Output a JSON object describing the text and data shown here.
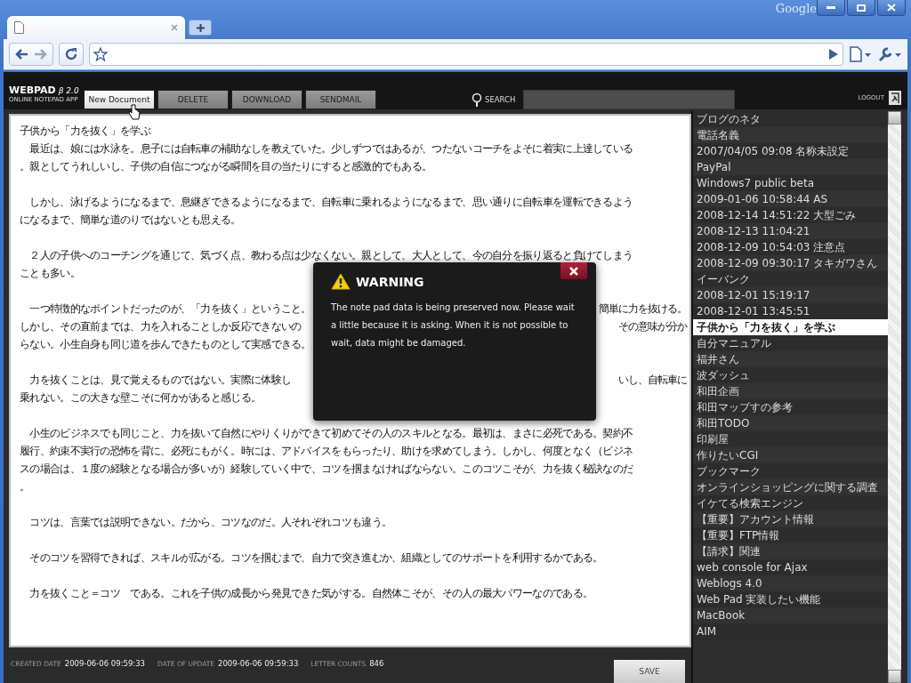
{
  "browser": {
    "brand": "Google"
  },
  "app": {
    "logo": "WEBPAD",
    "version": "β 2.0",
    "tagline": "ONLINE NOTEPAD APP",
    "buttons": [
      {
        "label": "New Document",
        "selected": true
      },
      {
        "label": "DELETE",
        "selected": false
      },
      {
        "label": "DOWNLOAD",
        "selected": false
      },
      {
        "label": "SENDMAIL",
        "selected": false
      }
    ],
    "search_label": "SEARCH",
    "logout": "LOGOUT"
  },
  "editor": {
    "title": "子供から「力を抜く」を学ぶ",
    "paragraphs": [
      {
        "lines": [
          {
            "kind": "full",
            "text": "　最近は、娘には水泳を。息子には自転車の補助なしを教えていた。少しずつではあるが、つたないコーチをよそに着実に上達している"
          },
          {
            "kind": "full",
            "text": "。親としてうれしいし、子供の自信につながる瞬間を目の当たりにすると感激的でもある。"
          }
        ]
      },
      {
        "lines": [
          {
            "kind": "full",
            "text": "　しかし、泳げるようになるまで、息継ぎできるようになるまで、自転車に乗れるようになるまで、思い通りに自転車を運転できるよう"
          },
          {
            "kind": "full",
            "text": "になるまで、簡単な道のりではないとも思える。"
          }
        ]
      },
      {
        "lines": [
          {
            "kind": "full",
            "text": "　２人の子供へのコーチングを通じて、気づく点、教わる点は少なくない。親として、大人として、今の自分を振り返ると負けてしまう"
          },
          {
            "kind": "full",
            "text": "ことも多い。"
          }
        ]
      },
      {
        "lines": [
          {
            "kind": "split",
            "left": "　一つ特徴的なポイントだったのが、「力を抜く」ということ。",
            "right": "簡単に力を抜ける。"
          },
          {
            "kind": "split",
            "left": "しかし、その直前までは、力を入れることしか反応できないの",
            "right": "その意味が分か"
          },
          {
            "kind": "full",
            "text": "らない。小生自身も同じ道を歩んできたものとして実感できる。"
          }
        ]
      },
      {
        "lines": [
          {
            "kind": "split",
            "left": "　力を抜くことは、見て覚えるものではない。実際に体験し",
            "right": "いし、自転車に"
          },
          {
            "kind": "full",
            "text": "乗れない。この大きな壁こそに何かがあると感じる。"
          }
        ]
      },
      {
        "lines": [
          {
            "kind": "full",
            "text": "　小生のビジネスでも同じこと、力を抜いて自然にやりくりができて初めてその人のスキルとなる。最初は、まさに必死である。契約不"
          },
          {
            "kind": "full",
            "text": "履行、約束不実行の恐怖を背に、必死にもがく。時には、アドバイスをもらったり、助けを求めてしまう。しかし、何度となく（ビジネ"
          },
          {
            "kind": "full",
            "text": "スの場合は、１度の経験となる場合が多いが）経験していく中で、コツを掴まなければならない。このコツこそが、力を抜く秘訣なのだ"
          },
          {
            "kind": "full",
            "text": "。"
          }
        ]
      },
      {
        "lines": [
          {
            "kind": "full",
            "text": "　コツは、言葉では説明できない。だから、コツなのだ。人それぞれコツも違う。"
          }
        ]
      },
      {
        "lines": [
          {
            "kind": "full",
            "text": "　そのコツを習得できれば、スキルが広がる。コツを掴むまで、自力で突き進むか、組織としてのサポートを利用するかである。"
          }
        ]
      },
      {
        "lines": [
          {
            "kind": "full",
            "text": "　力を抜くこと＝コツ　である。これを子供の成長から発見できた気がする。自然体こそが、その人の最大パワーなのである。"
          }
        ]
      }
    ]
  },
  "footer": {
    "fields": [
      {
        "label": "CREATED DATE",
        "value": "2009-06-06 09:59:33"
      },
      {
        "label": "DATE OF UPDATE",
        "value": "2009-06-06 09:59:33"
      },
      {
        "label": "LETTER COUNTS",
        "value": "846"
      }
    ],
    "save": "SAVE"
  },
  "notes": [
    {
      "title": "ブログのネタ",
      "selected": false
    },
    {
      "title": "電話名義",
      "selected": false
    },
    {
      "title": "2007/04/05 09:08 名称未設定",
      "selected": false
    },
    {
      "title": "PayPal",
      "selected": false
    },
    {
      "title": "Windows7 public beta",
      "selected": false
    },
    {
      "title": "2009-01-06 10:58:44 AS",
      "selected": false
    },
    {
      "title": "2008-12-14 14:51:22 大型ごみ",
      "selected": false
    },
    {
      "title": "2008-12-13 11:04:21",
      "selected": false
    },
    {
      "title": "2008-12-09 10:54:03 注意点",
      "selected": false
    },
    {
      "title": "2008-12-09 09:30:17 タキガワさん",
      "selected": false
    },
    {
      "title": "イーバンク",
      "selected": false
    },
    {
      "title": "2008-12-01 15:19:17",
      "selected": false
    },
    {
      "title": "2008-12-01 13:45:51",
      "selected": false
    },
    {
      "title": "子供から「力を抜く」を学ぶ",
      "selected": true
    },
    {
      "title": "自分マニュアル",
      "selected": false
    },
    {
      "title": "福井さん",
      "selected": false
    },
    {
      "title": "波ダッシュ",
      "selected": false
    },
    {
      "title": "和田企画",
      "selected": false
    },
    {
      "title": "和田マップすの参考",
      "selected": false
    },
    {
      "title": "和田TODO",
      "selected": false
    },
    {
      "title": "印刷屋",
      "selected": false
    },
    {
      "title": "作りたいCGI",
      "selected": false
    },
    {
      "title": "ブックマーク",
      "selected": false
    },
    {
      "title": "オンラインショッピングに関する調査",
      "selected": false
    },
    {
      "title": "イケてる検索エンジン",
      "selected": false
    },
    {
      "title": "【重要】アカウント情報",
      "selected": false
    },
    {
      "title": "【重要】FTP情報",
      "selected": false
    },
    {
      "title": "【請求】関連",
      "selected": false
    },
    {
      "title": "web console for Ajax",
      "selected": false
    },
    {
      "title": "Weblogs 4.0",
      "selected": false
    },
    {
      "title": "Web Pad 実装したい機能",
      "selected": false
    },
    {
      "title": "MacBook",
      "selected": false
    },
    {
      "title": "AIM",
      "selected": false
    }
  ],
  "dialog": {
    "title": "WARNING",
    "message": "The note pad data is being preserved now. Please wait a little because it is asking. When it is not possible to wait, data might be damaged."
  }
}
